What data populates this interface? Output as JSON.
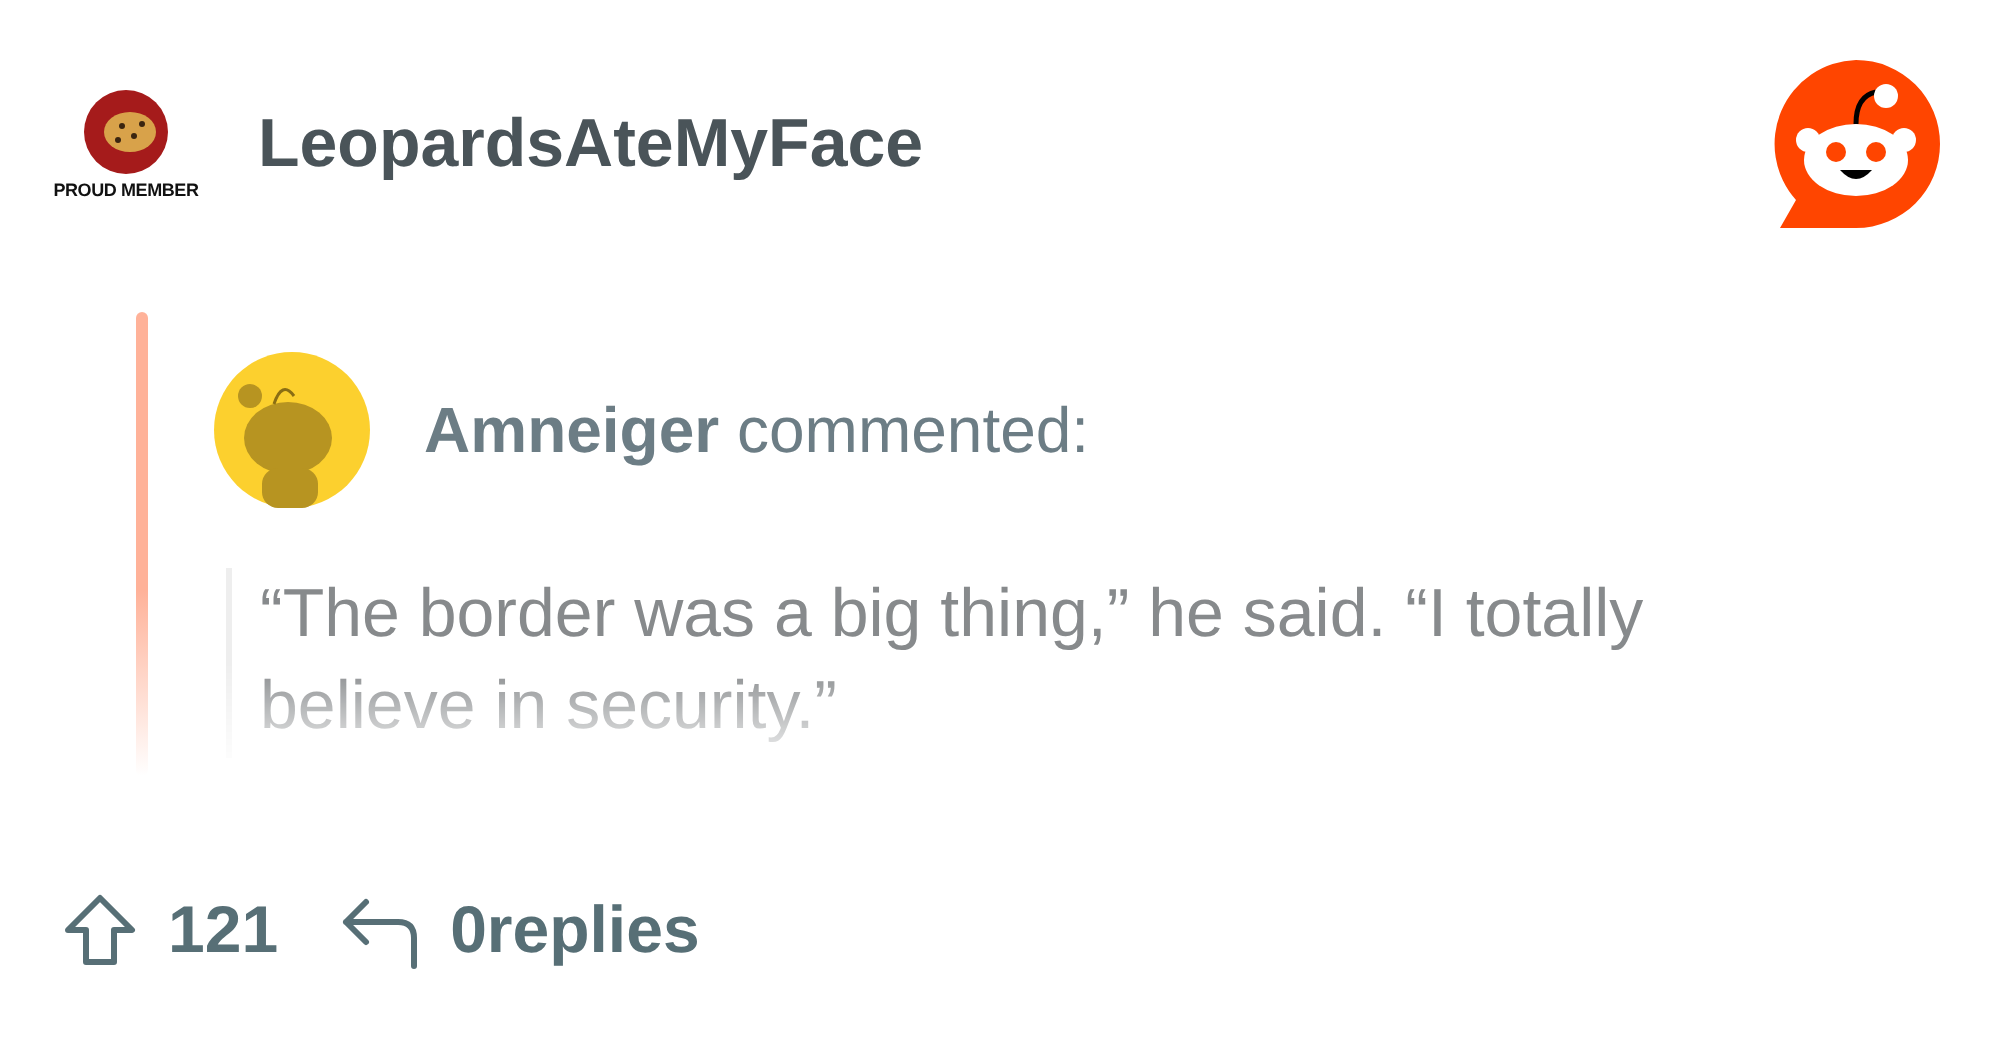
{
  "header": {
    "community_badge": {
      "text": "PROUD MEMBER"
    },
    "community": "LeopardsAteMyFace"
  },
  "comment": {
    "author": "Amneiger",
    "action": "commented:",
    "quote": "“The border was a big thing,” he said. “I totally believe in security.”"
  },
  "footer": {
    "upvotes": "121",
    "replies": "0replies"
  }
}
